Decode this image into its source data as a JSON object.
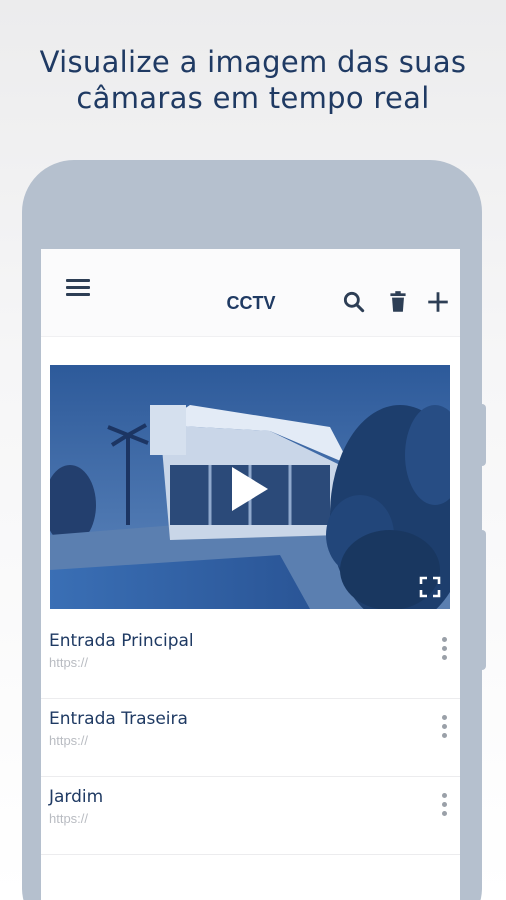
{
  "headline": {
    "line1": "Visualize a imagem das suas",
    "line2": "câmaras em tempo real"
  },
  "app": {
    "title": "CCTV",
    "icons": [
      "menu-icon",
      "search-icon",
      "trash-icon",
      "plus-icon"
    ]
  },
  "camera_preview": {
    "icons": [
      "play-icon",
      "fullscreen-icon"
    ]
  },
  "cameras": [
    {
      "name": "Entrada Principal",
      "url": "https://"
    },
    {
      "name": "Entrada Traseira",
      "url": "https://"
    },
    {
      "name": "Jardim",
      "url": "https://"
    }
  ],
  "colors": {
    "accent": "#1f3a63",
    "phone_frame": "#b5c0ce",
    "muted_text": "#b9bcc2"
  }
}
